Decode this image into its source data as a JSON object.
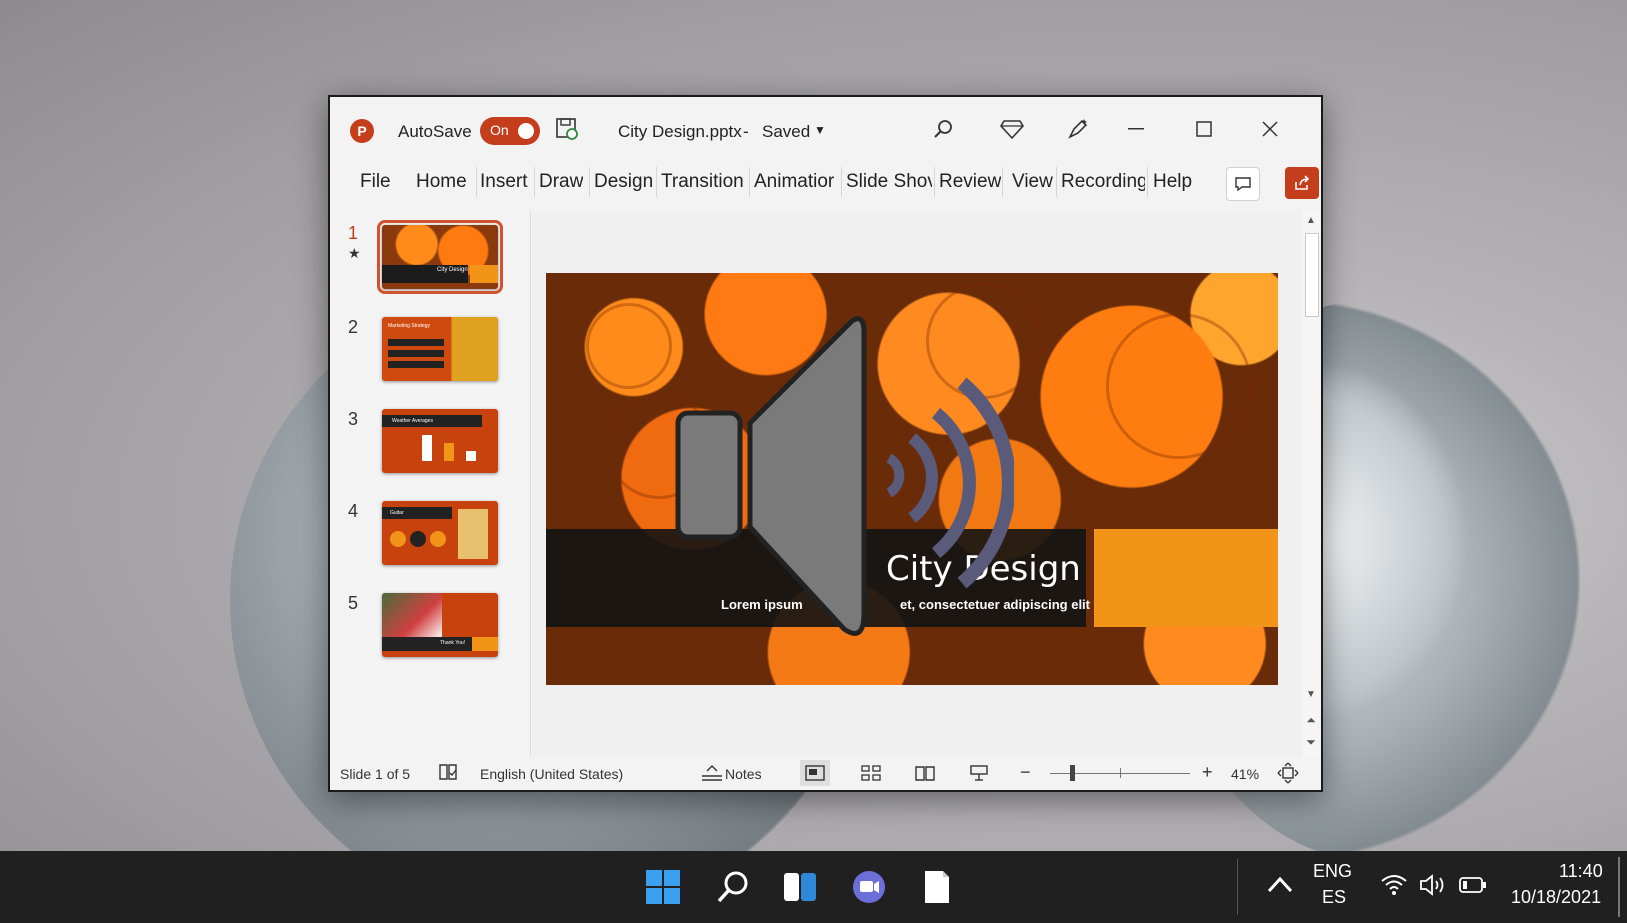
{
  "window": {
    "autosave_label": "AutoSave",
    "autosave_state": "On",
    "doc_title": "City Design.pptx",
    "doc_sep": "-",
    "doc_status": "Saved"
  },
  "ribbon": {
    "tabs": [
      "File",
      "Home",
      "Insert",
      "Draw",
      "Design",
      "Transition",
      "Animatior",
      "Slide Shov",
      "Review",
      "View",
      "Recording",
      "Help"
    ]
  },
  "slides": {
    "numbers": [
      "1",
      "2",
      "3",
      "4",
      "5"
    ],
    "thumb_titles": [
      "City Design",
      "Marketing Strategy",
      "Weather Averages",
      "Guitar",
      "Thank You!"
    ]
  },
  "slide": {
    "title": "City Design",
    "subtitle_left": "Lorem ipsum",
    "subtitle_right": "et, consectetuer adipiscing elit"
  },
  "status": {
    "slide_info": "Slide 1 of 5",
    "language": "English (United States)",
    "notes_label": "Notes",
    "zoom_minus": "−",
    "zoom_plus": "+",
    "zoom_level": "41%"
  },
  "taskbar": {
    "lang_top": "ENG",
    "lang_bottom": "ES",
    "time": "11:40",
    "date": "10/18/2021"
  },
  "colors": {
    "accent": "#c43e1c",
    "slide_orange": "#f29418",
    "banner": "#141414"
  }
}
